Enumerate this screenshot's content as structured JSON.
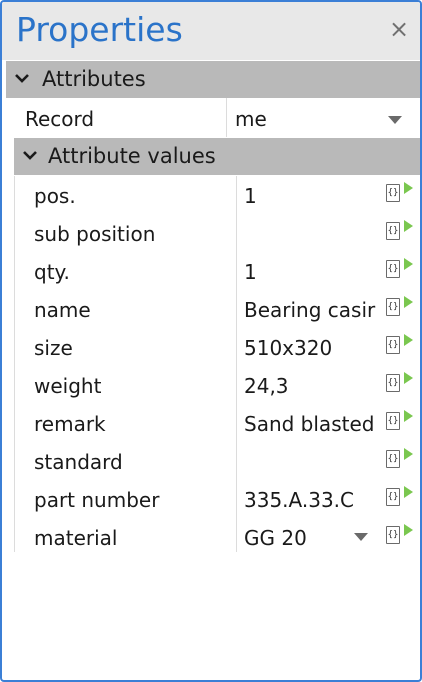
{
  "panel": {
    "title": "Properties",
    "close_glyph": "×"
  },
  "attributes_section": {
    "label": "Attributes",
    "record": {
      "key": "Record",
      "value": "me"
    }
  },
  "attribute_values_section": {
    "label": "Attribute values",
    "rows": [
      {
        "key": "pos.",
        "value": "1"
      },
      {
        "key": "sub position",
        "value": ""
      },
      {
        "key": "qty.",
        "value": "1"
      },
      {
        "key": "name",
        "value": "Bearing casir"
      },
      {
        "key": "size",
        "value": "510x320"
      },
      {
        "key": "weight",
        "value": "24,3"
      },
      {
        "key": "remark",
        "value": "Sand blasted"
      },
      {
        "key": "standard",
        "value": ""
      },
      {
        "key": "part number",
        "value": "335.A.33.C"
      },
      {
        "key": "material",
        "value": "GG 20"
      }
    ]
  },
  "icons": {
    "collapse": "chevron-down-icon",
    "dropdown": "dropdown-arrow-icon",
    "expression": "expression-braces-icon",
    "run": "play-arrow-icon",
    "expression_glyph": "{}"
  },
  "colors": {
    "accent_border": "#3b7fd6",
    "title_text": "#2a73c9",
    "section_header": "#b9b9b9",
    "run_arrow": "#7ac74f"
  }
}
